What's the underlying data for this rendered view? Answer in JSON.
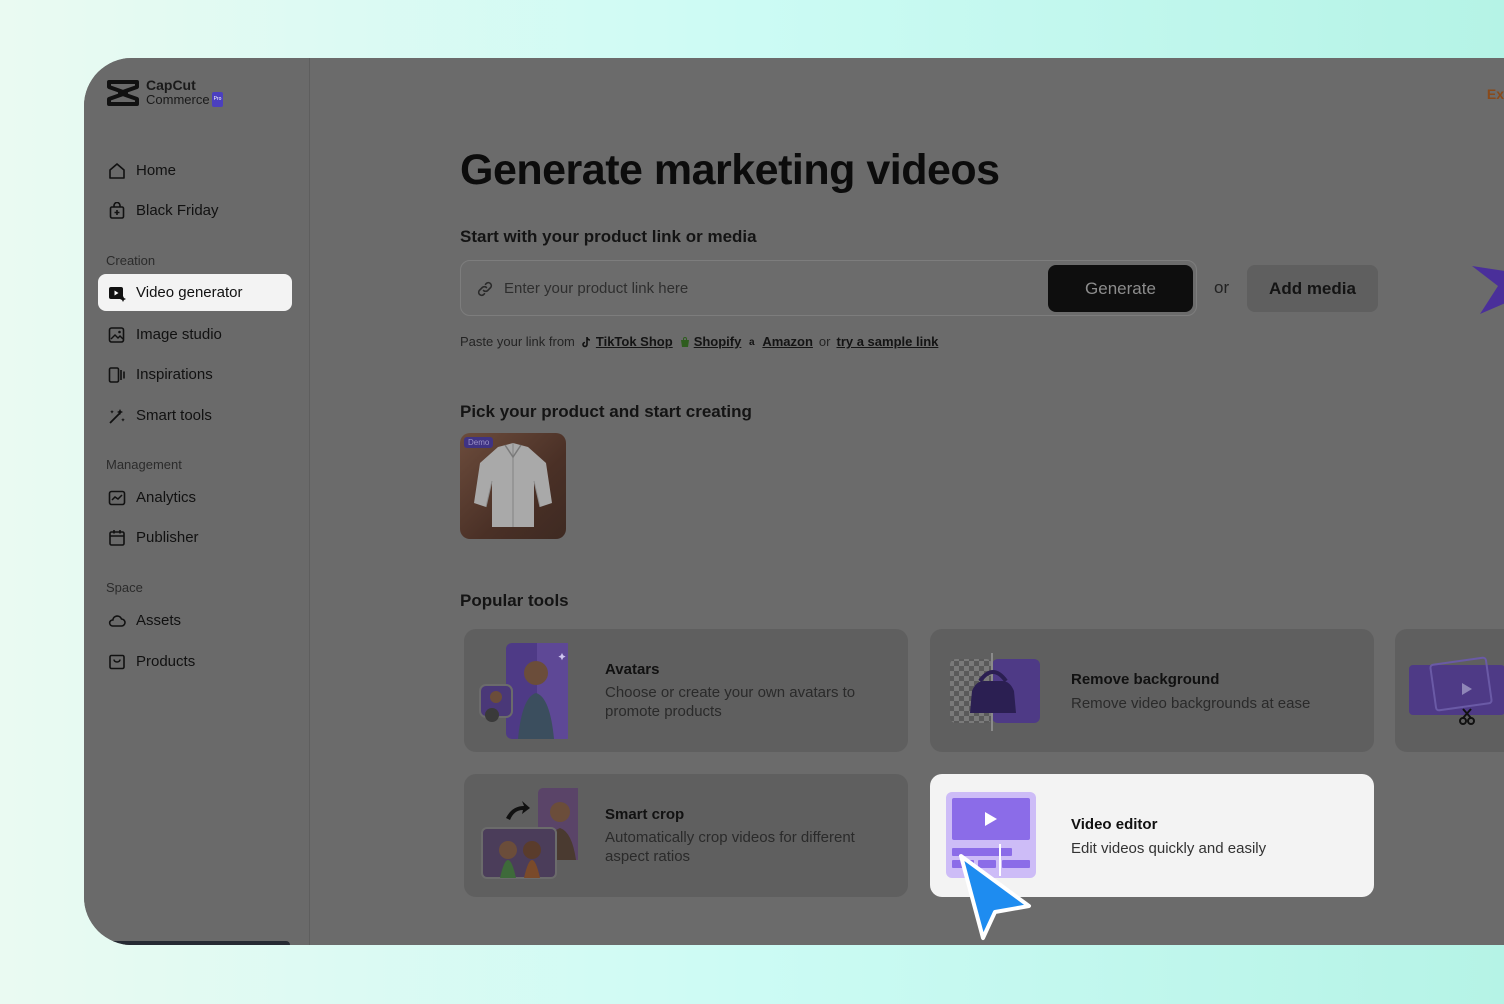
{
  "brand": {
    "line1": "CapCut",
    "line2": "Commerce",
    "badge": "Pro"
  },
  "sidebar": {
    "top_items": [
      {
        "label": "Home",
        "icon": "home-icon"
      },
      {
        "label": "Black Friday",
        "icon": "shopping-bag-icon"
      }
    ],
    "sections": [
      {
        "label": "Creation",
        "items": [
          {
            "label": "Video generator",
            "icon": "video-sparkle-icon",
            "active": true
          },
          {
            "label": "Image studio",
            "icon": "image-sparkle-icon"
          },
          {
            "label": "Inspirations",
            "icon": "inspirations-icon"
          },
          {
            "label": "Smart tools",
            "icon": "magic-wand-icon"
          }
        ]
      },
      {
        "label": "Management",
        "items": [
          {
            "label": "Analytics",
            "icon": "analytics-icon"
          },
          {
            "label": "Publisher",
            "icon": "calendar-icon"
          }
        ]
      },
      {
        "label": "Space",
        "items": [
          {
            "label": "Assets",
            "icon": "cloud-icon"
          },
          {
            "label": "Products",
            "icon": "box-icon"
          }
        ]
      }
    ]
  },
  "header": {
    "corner_text": "Ex"
  },
  "main": {
    "title": "Generate marketing videos",
    "link_section": {
      "heading": "Start with your product link or media",
      "placeholder": "Enter your product link here",
      "generate_label": "Generate",
      "or_label": "or",
      "add_media_label": "Add media",
      "paste_prefix": "Paste your link from",
      "sources": [
        "TikTok Shop",
        "Shopify",
        "Amazon"
      ],
      "or_text": "or",
      "sample_link": "try a sample link"
    },
    "product_section": {
      "heading": "Pick your product and start creating",
      "demo_label": "Demo"
    },
    "tools_section": {
      "heading": "Popular tools",
      "tools": [
        {
          "title": "Avatars",
          "desc": "Choose or create your own avatars to promote products"
        },
        {
          "title": "Remove background",
          "desc": "Remove video backgrounds at ease"
        },
        {
          "title": "Smart crop",
          "desc": "Automatically crop videos for different aspect ratios"
        },
        {
          "title": "Video editor",
          "desc": "Edit videos quickly and easily"
        }
      ]
    }
  },
  "colors": {
    "accent_purple": "#7b5ce6",
    "cursor_blue": "#1e8cf0",
    "overlay": "#6b6b6b"
  }
}
